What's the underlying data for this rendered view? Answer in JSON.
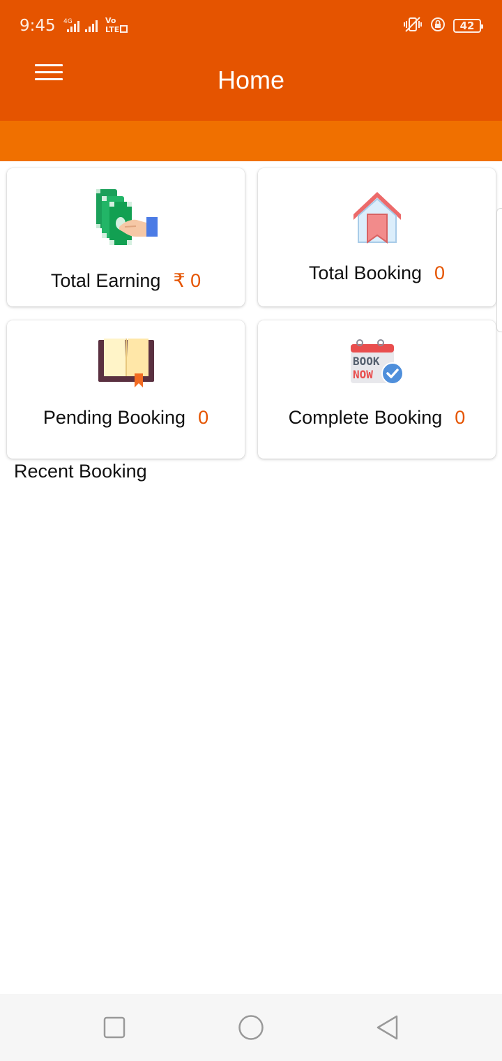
{
  "status_bar": {
    "time": "9:45",
    "network_label": "4G",
    "volte_label": "Vo LTE",
    "battery_level": "42",
    "icons": [
      "signal-icon",
      "signal-icon",
      "volte-icon",
      "vibrate-icon",
      "rotation-lock-icon",
      "battery-icon"
    ]
  },
  "app_bar": {
    "title": "Home",
    "menu_icon": "hamburger-menu-icon"
  },
  "colors": {
    "primary": "#E55400",
    "band": "#F07000",
    "value_text": "#E55400"
  },
  "cards": [
    {
      "label": "Total Earning",
      "value": "₹ 0",
      "icon": "money-hand-icon"
    },
    {
      "label": "Total Booking",
      "value": "0",
      "icon": "house-icon"
    },
    {
      "label": "Pending Booking",
      "value": "0",
      "icon": "open-book-icon"
    },
    {
      "label": "Complete Booking",
      "value": "0",
      "icon": "book-now-calendar-icon"
    }
  ],
  "recent": {
    "title": "Recent Booking"
  },
  "nav": {
    "icons": [
      "recents-square-icon",
      "home-circle-icon",
      "back-triangle-icon"
    ]
  }
}
